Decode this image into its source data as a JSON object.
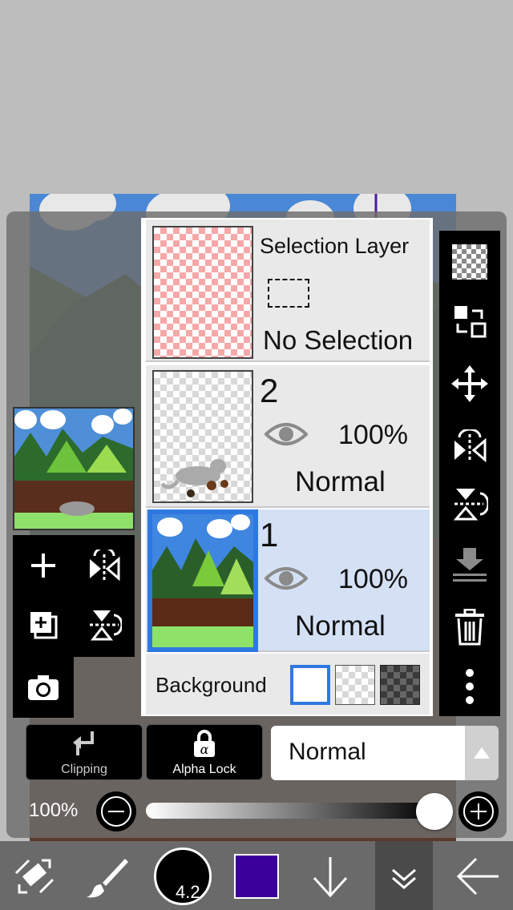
{
  "layers_panel": {
    "selection_layer": {
      "title": "Selection Layer",
      "status": "No Selection"
    },
    "layers": [
      {
        "number": "2",
        "opacity": "100%",
        "blend": "Normal",
        "selected": false
      },
      {
        "number": "1",
        "opacity": "100%",
        "blend": "Normal",
        "selected": true
      }
    ],
    "background_label": "Background"
  },
  "mode_buttons": {
    "clipping": "Clipping",
    "alpha_lock": "Alpha Lock"
  },
  "blend_mode": {
    "value": "Normal"
  },
  "opacity": {
    "label": "100%",
    "value": 1.0
  },
  "bottom_toolbar": {
    "brush_size": "4.2",
    "current_color": "#3a0099"
  },
  "colors": {
    "selected_layer_bg": "#d4e1f5",
    "selected_accent": "#2f78e0",
    "toolbar_bg": "#6a6a6a"
  },
  "icons": [
    "checker-icon",
    "move-transfer-icon",
    "move-icon",
    "flip-horizontal-icon",
    "flip-vertical-icon",
    "merge-down-icon",
    "trash-icon",
    "more-icon",
    "add-layer-icon",
    "copy-layer-icon",
    "camera-icon",
    "clipping-icon",
    "alpha-lock-icon",
    "eye-icon",
    "transform-icon",
    "brush-icon",
    "down-arrow-icon",
    "chevron-down-icon",
    "back-arrow-icon"
  ]
}
